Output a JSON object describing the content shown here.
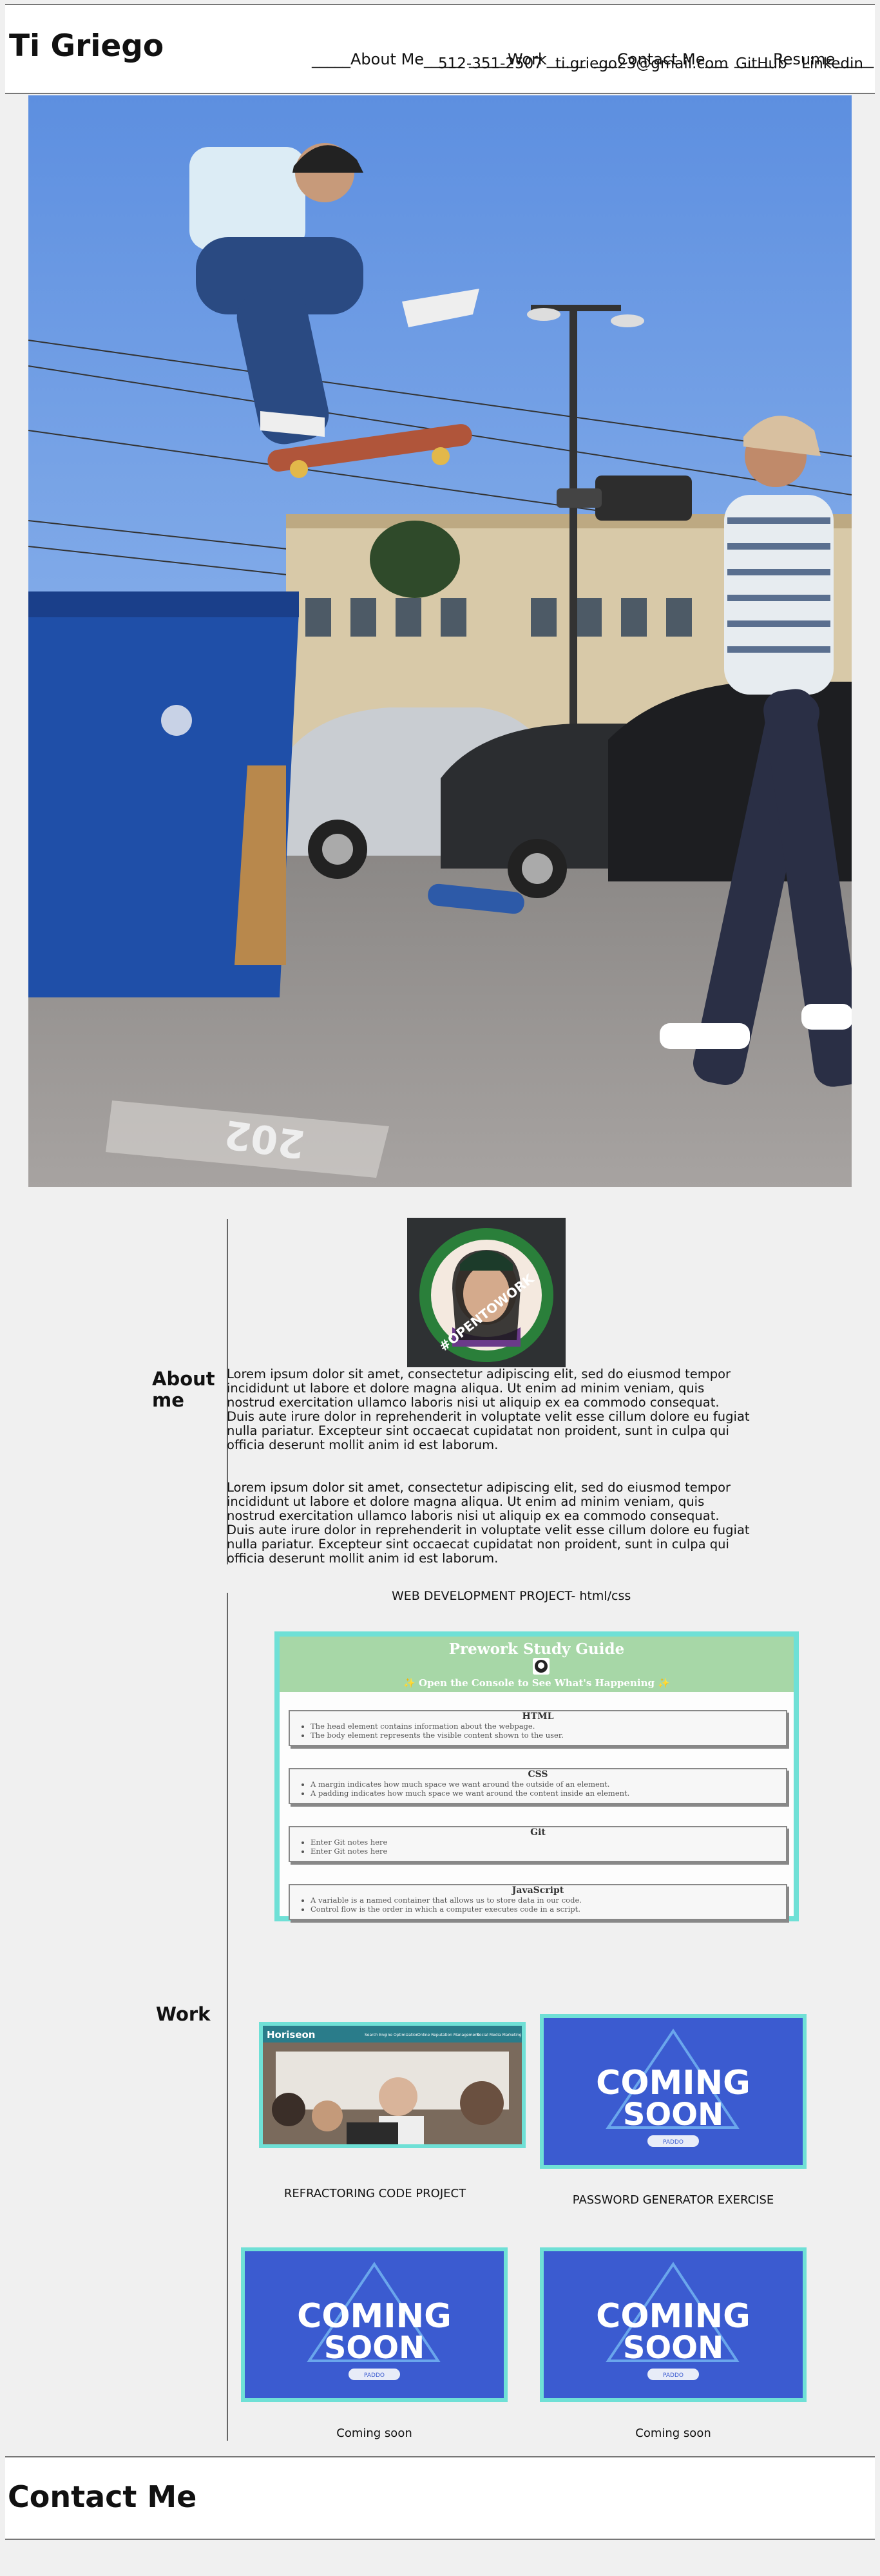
{
  "header": {
    "title": "Ti Griego",
    "nav": [
      {
        "label": "_____About Me_____"
      },
      {
        "label": "_____Work_____"
      },
      {
        "label": "___Contact Me___"
      },
      {
        "label": "_____Resume_____"
      }
    ]
  },
  "hero": {
    "icon": "skateboard-photo"
  },
  "about": {
    "label": "About me",
    "avatar_text": "#OPENTOWORK",
    "paragraphs": [
      "Lorem ipsum dolor sit amet, consectetur adipiscing elit, sed do eiusmod tempor incididunt ut labore et dolore magna aliqua. Ut enim ad minim veniam, quis nostrud exercitation ullamco laboris nisi ut aliquip ex ea commodo consequat. Duis aute irure dolor in reprehenderit in voluptate velit esse cillum dolore eu fugiat nulla pariatur. Excepteur sint occaecat cupidatat non proident, sunt in culpa qui officia deserunt mollit anim id est laborum.",
      "Lorem ipsum dolor sit amet, consectetur adipiscing elit, sed do eiusmod tempor incididunt ut labore et dolore magna aliqua. Ut enim ad minim veniam, quis nostrud exercitation ullamco laboris nisi ut aliquip ex ea commodo consequat. Duis aute irure dolor in reprehenderit in voluptate velit esse cillum dolore eu fugiat nulla pariatur. Excepteur sint occaecat cupidatat non proident, sunt in culpa qui officia deserunt mollit anim id est laborum."
    ]
  },
  "work": {
    "label": "Work",
    "featured_title": "WEB DEVELOPMENT PROJECT- html/css",
    "guide": {
      "title": "Prework Study Guide",
      "subtitle": "✨ Open the Console to See What's Happening ✨",
      "sections": [
        {
          "title": "HTML",
          "items": [
            "The head element contains information about the webpage.",
            "The body element represents the visible content shown to the user."
          ]
        },
        {
          "title": "CSS",
          "items": [
            "A margin indicates how much space we want around the outside of an element.",
            "A padding indicates how much space we want around the content inside an element."
          ]
        },
        {
          "title": "Git",
          "items": [
            "Enter Git notes here",
            "Enter Git notes here"
          ]
        },
        {
          "title": "JavaScript",
          "items": [
            "A variable is a named container that allows us to store data in our code.",
            "Control flow is the order in which a computer executes code in a script."
          ]
        }
      ]
    },
    "horiseon": {
      "brand": "Horiseon",
      "nav": [
        "Search Engine Optimization",
        "Online Reputation Management",
        "Social Media Marketing"
      ]
    },
    "coming_soon": {
      "line1": "COMING",
      "line2": "SOON",
      "badge": "PADDO"
    },
    "captions": [
      "REFRACTORING CODE PROJECT",
      "PASSWORD GENERATOR EXERCISE",
      "Coming soon",
      "Coming soon"
    ]
  },
  "contact": {
    "title": "Contact Me",
    "phone": "512-351-2507",
    "email": "ti.griego23@gmail.com",
    "github": "GitHub",
    "linkedin": "Linkedin"
  }
}
